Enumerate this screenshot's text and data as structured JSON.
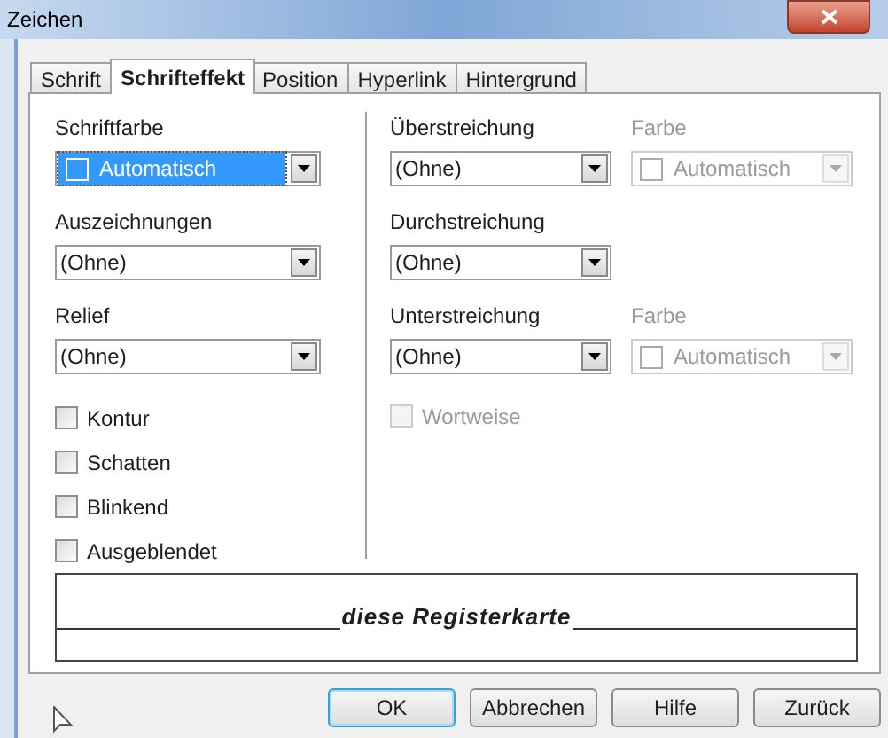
{
  "window": {
    "title": "Zeichen"
  },
  "tabs": [
    {
      "label": "Schrift",
      "selected": false
    },
    {
      "label": "Schrifteffekt",
      "selected": true
    },
    {
      "label": "Position",
      "selected": false
    },
    {
      "label": "Hyperlink",
      "selected": false
    },
    {
      "label": "Hintergrund",
      "selected": false
    }
  ],
  "left": {
    "fields": [
      {
        "label": "Schriftfarbe",
        "kind": "color",
        "value": "Automatisch",
        "focused": true
      },
      {
        "label": "Auszeichnungen",
        "kind": "list",
        "value": "(Ohne)",
        "focused": false
      },
      {
        "label": "Relief",
        "kind": "list",
        "value": "(Ohne)",
        "focused": false
      }
    ],
    "checkboxes": [
      {
        "label": "Kontur",
        "checked": false,
        "disabled": false
      },
      {
        "label": "Schatten",
        "checked": false,
        "disabled": false
      },
      {
        "label": "Blinkend",
        "checked": false,
        "disabled": false
      },
      {
        "label": "Ausgeblendet",
        "checked": false,
        "disabled": false
      }
    ]
  },
  "right": {
    "fields": [
      {
        "label": "Überstreichung",
        "value": "(Ohne)",
        "color": {
          "label": "Farbe",
          "value": "Automatisch",
          "disabled": true
        }
      },
      {
        "label": "Durchstreichung",
        "value": "(Ohne)"
      },
      {
        "label": "Unterstreichung",
        "value": "(Ohne)",
        "color": {
          "label": "Farbe",
          "value": "Automatisch",
          "disabled": true
        }
      }
    ],
    "checkboxes": [
      {
        "label": "Wortweise",
        "checked": false,
        "disabled": true
      }
    ]
  },
  "preview": {
    "text": "diese Registerkarte"
  },
  "buttons": [
    {
      "label": "OK",
      "default": true
    },
    {
      "label": "Abbrechen",
      "default": false
    },
    {
      "label": "Hilfe",
      "default": false
    },
    {
      "label": "Zurück",
      "default": false
    }
  ]
}
